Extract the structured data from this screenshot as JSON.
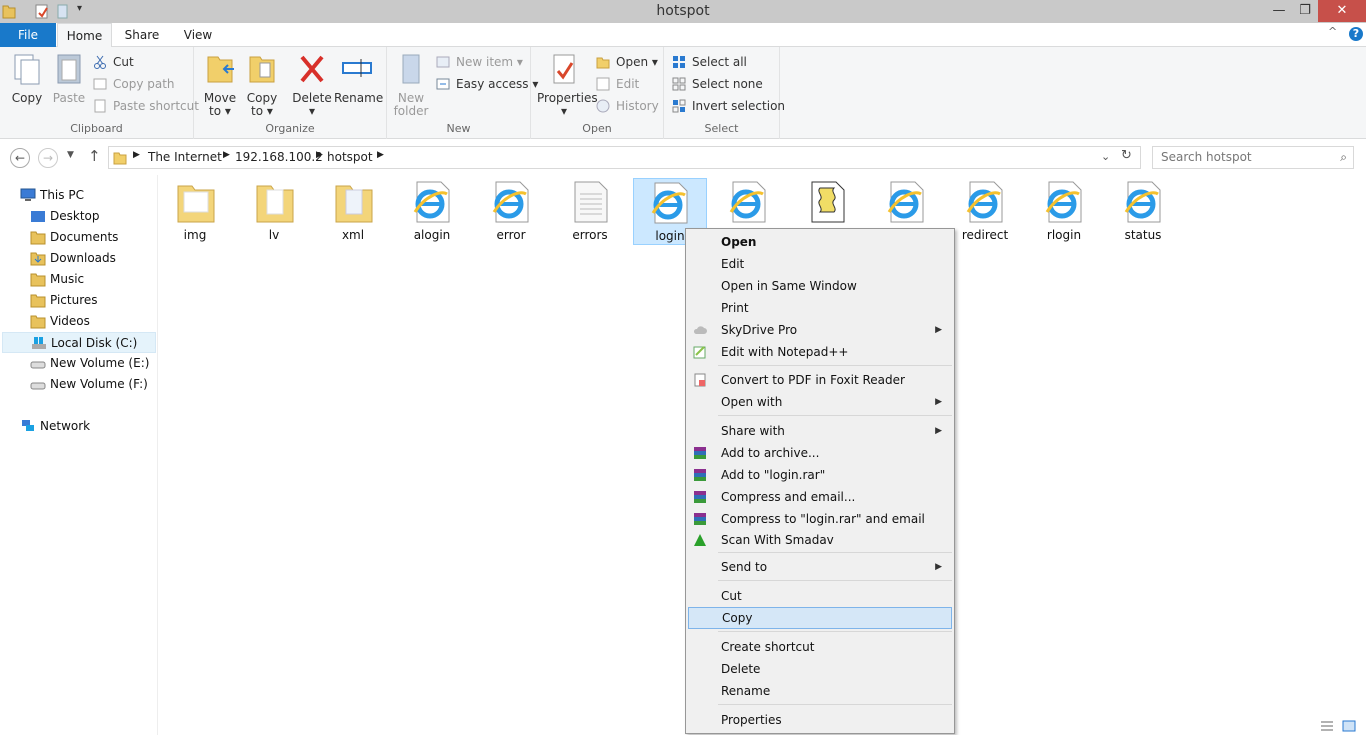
{
  "window": {
    "title": "hotspot",
    "minimize": "—",
    "maximize": "❐",
    "close": "✕"
  },
  "tabs": {
    "file": "File",
    "home": "Home",
    "share": "Share",
    "view": "View",
    "help": "?",
    "collapse": "^"
  },
  "ribbon": {
    "clipboard": {
      "label": "Clipboard",
      "copy": "Copy",
      "paste": "Paste",
      "cut": "Cut",
      "copy_path": "Copy path",
      "paste_shortcut": "Paste shortcut"
    },
    "organize": {
      "label": "Organize",
      "move_to": "Move",
      "move_to2": "to",
      "copy_to": "Copy",
      "copy_to2": "to",
      "delete": "Delete",
      "rename": "Rename"
    },
    "new": {
      "label": "New",
      "new_folder": "New",
      "new_folder2": "folder",
      "new_item": "New item",
      "easy_access": "Easy access"
    },
    "open": {
      "label": "Open",
      "properties": "Properties",
      "open": "Open",
      "edit": "Edit",
      "history": "History"
    },
    "select": {
      "label": "Select",
      "select_all": "Select all",
      "select_none": "Select none",
      "invert": "Invert selection"
    }
  },
  "address": {
    "crumbs": [
      "The Internet",
      "192.168.100.2",
      "hotspot"
    ],
    "search_placeholder": "Search hotspot"
  },
  "nav": {
    "items": [
      "This PC",
      "Desktop",
      "Documents",
      "Downloads",
      "Music",
      "Pictures",
      "Videos",
      "Local Disk (C:)",
      "New Volume (E:)",
      "New Volume (F:)",
      "Network"
    ]
  },
  "files": [
    "img",
    "lv",
    "xml",
    "alogin",
    "error",
    "errors",
    "login",
    "",
    "",
    "",
    "redirect",
    "rlogin",
    "status"
  ],
  "menu": {
    "open": "Open",
    "edit": "Edit",
    "open_same": "Open in Same Window",
    "print": "Print",
    "skydrive": "SkyDrive Pro",
    "notepad": "Edit with Notepad++",
    "pdf": "Convert to PDF in Foxit Reader",
    "open_with": "Open with",
    "share_with": "Share with",
    "add_archive": "Add to archive...",
    "add_rar": "Add to \"login.rar\"",
    "compress_email": "Compress and email...",
    "compress_rar_email": "Compress to \"login.rar\" and email",
    "smadav": "Scan With Smadav",
    "send_to": "Send to",
    "cut": "Cut",
    "copy": "Copy",
    "create_shortcut": "Create shortcut",
    "delete": "Delete",
    "rename": "Rename",
    "properties": "Properties"
  },
  "colors": {
    "accent": "#1979ca",
    "close": "#c7504a",
    "selection": "#cce8ff"
  }
}
